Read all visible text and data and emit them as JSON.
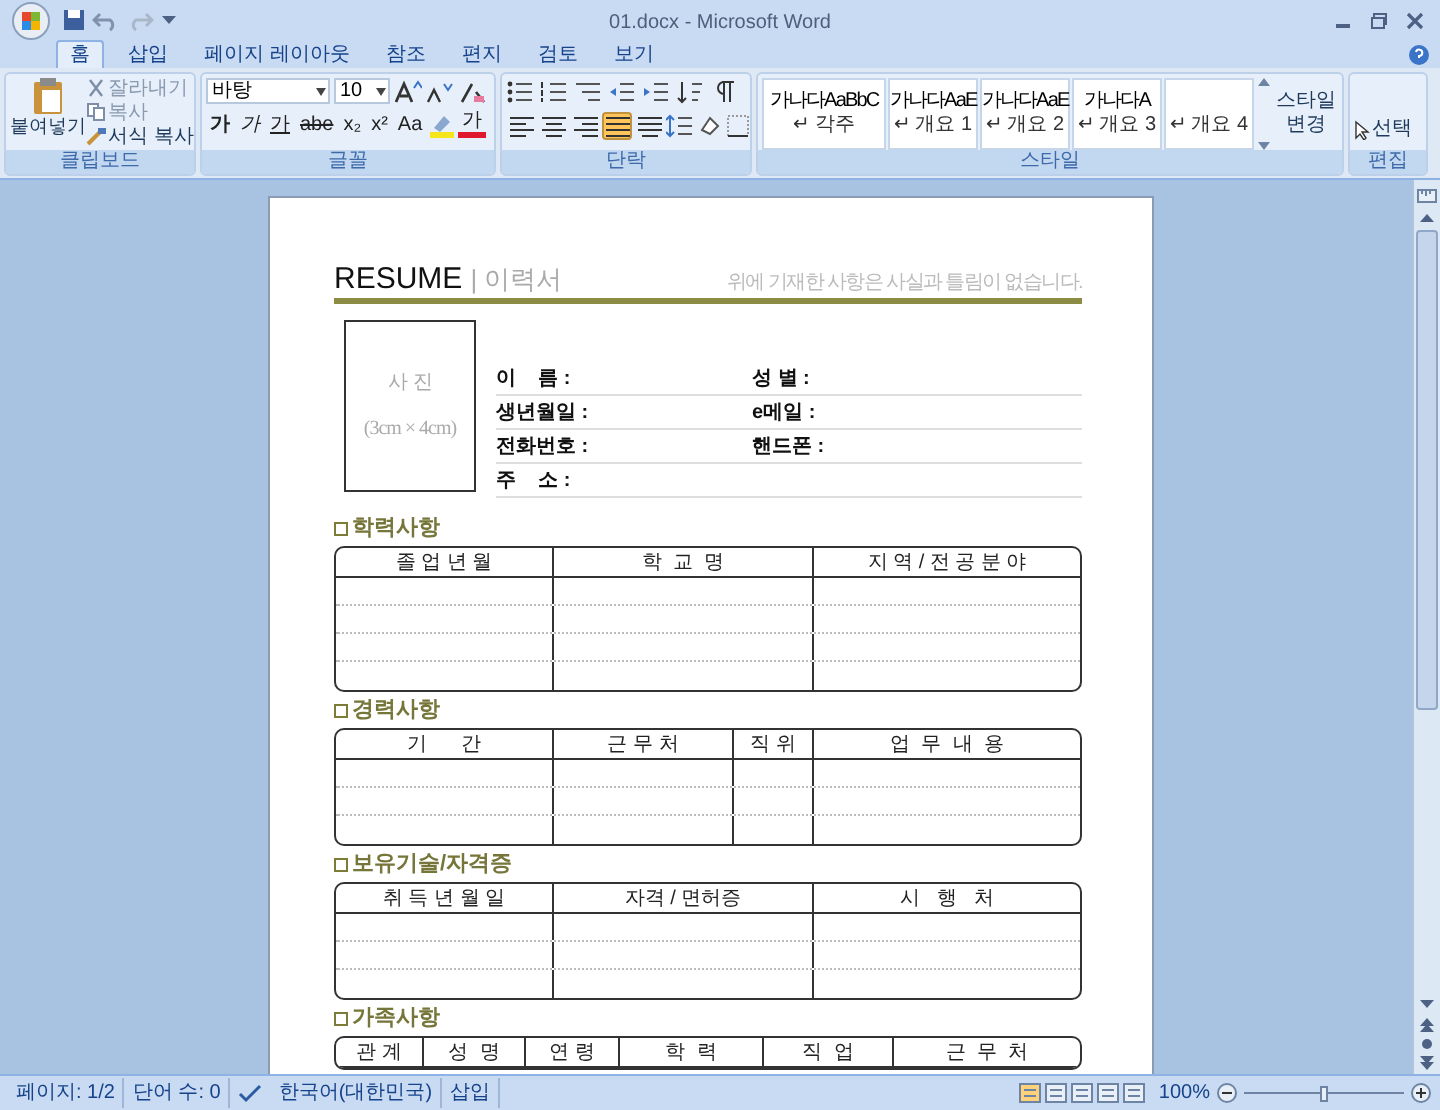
{
  "window": {
    "title": "01.docx - Microsoft Word"
  },
  "tabs": [
    {
      "label": "홈",
      "selected": true
    },
    {
      "label": "삽입",
      "selected": false
    },
    {
      "label": "페이지 레이아웃",
      "selected": false
    },
    {
      "label": "참조",
      "selected": false
    },
    {
      "label": "편지",
      "selected": false
    },
    {
      "label": "검토",
      "selected": false
    },
    {
      "label": "보기",
      "selected": false
    }
  ],
  "ribbon": {
    "clipboard": {
      "label": "클립보드",
      "paste": "붙여넣기",
      "commands": [
        "잘라내기",
        "복사",
        "서식 복사"
      ]
    },
    "font": {
      "label": "글꼴",
      "font_name": "바탕",
      "font_size": "10",
      "buttons": [
        "가",
        "가",
        "가",
        "abe",
        "x₂",
        "x²",
        "Aa"
      ],
      "font_color": "가"
    },
    "paragraph": {
      "label": "단락",
      "alignments": [
        {
          "selected": false
        },
        {
          "selected": false
        },
        {
          "selected": false
        },
        {
          "selected": true
        },
        {
          "selected": false
        }
      ]
    },
    "styles": {
      "label": "스타일",
      "items": [
        {
          "sample": "가나다AaBbC",
          "name": "↵ 각주"
        },
        {
          "sample": "가나다AaE",
          "name": "↵ 개요 1"
        },
        {
          "sample": "가나다AaE",
          "name": "↵ 개요 2"
        },
        {
          "sample": "가나다A",
          "name": "↵ 개요 3"
        },
        {
          "name": "↵ 개요 4"
        }
      ],
      "change": "스타일 변경"
    },
    "editing": {
      "label": "편집",
      "select": "선택"
    }
  },
  "document": {
    "title": "RESUME",
    "subtitle": "| 이력서",
    "note": "위에 기재한 사항은 사실과 틀림이 없습니다.",
    "photo": {
      "label": "사 진",
      "size": "(3cm × 4cm)"
    },
    "fields": [
      {
        "left": "이    름 :",
        "right": "성 별 :"
      },
      {
        "left": "생년월일 :",
        "right": "e메일 :"
      },
      {
        "left": "전화번호 :",
        "right": "핸드폰 :"
      },
      {
        "left": "주    소 :"
      }
    ],
    "sections": [
      {
        "title": "학력사항",
        "columns": [
          "졸 업 년 월",
          "학  교  명",
          "지 역 / 전 공 분 야"
        ]
      },
      {
        "title": "경력사항",
        "columns": [
          "기      간",
          "근 무 처",
          "직 위",
          "업  무  내  용"
        ]
      },
      {
        "title": "보유기술/자격증",
        "columns": [
          "취 득 년 월 일",
          "자격 / 면허증",
          "시   행   처"
        ]
      },
      {
        "title": "가족사항",
        "columns": [
          "관 계",
          "성  명",
          "연 령",
          "학  력",
          "직  업",
          "근  무  처"
        ]
      }
    ]
  },
  "status_bar": {
    "page": "페이지: 1/2",
    "words": "단어 수: 0",
    "language": "한국어(대한민국)",
    "mode": "삽입",
    "zoom": "100%",
    "zoom_slider": {
      "level": 0.5
    }
  }
}
